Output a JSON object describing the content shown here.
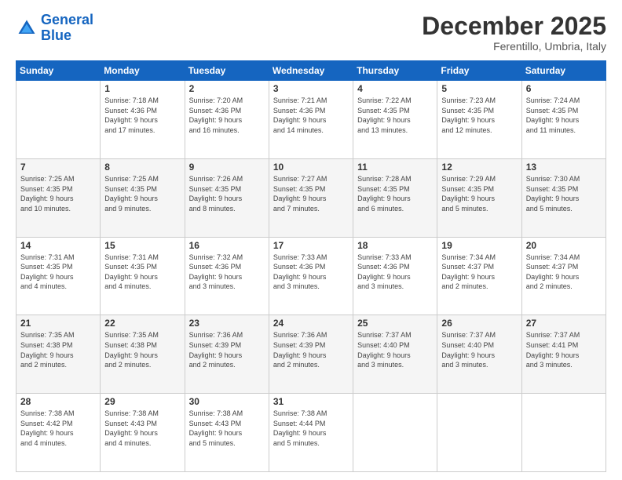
{
  "logo": {
    "line1": "General",
    "line2": "Blue"
  },
  "title": "December 2025",
  "subtitle": "Ferentillo, Umbria, Italy",
  "days_header": [
    "Sunday",
    "Monday",
    "Tuesday",
    "Wednesday",
    "Thursday",
    "Friday",
    "Saturday"
  ],
  "weeks": [
    [
      {
        "num": "",
        "info": ""
      },
      {
        "num": "1",
        "info": "Sunrise: 7:18 AM\nSunset: 4:36 PM\nDaylight: 9 hours\nand 17 minutes."
      },
      {
        "num": "2",
        "info": "Sunrise: 7:20 AM\nSunset: 4:36 PM\nDaylight: 9 hours\nand 16 minutes."
      },
      {
        "num": "3",
        "info": "Sunrise: 7:21 AM\nSunset: 4:36 PM\nDaylight: 9 hours\nand 14 minutes."
      },
      {
        "num": "4",
        "info": "Sunrise: 7:22 AM\nSunset: 4:35 PM\nDaylight: 9 hours\nand 13 minutes."
      },
      {
        "num": "5",
        "info": "Sunrise: 7:23 AM\nSunset: 4:35 PM\nDaylight: 9 hours\nand 12 minutes."
      },
      {
        "num": "6",
        "info": "Sunrise: 7:24 AM\nSunset: 4:35 PM\nDaylight: 9 hours\nand 11 minutes."
      }
    ],
    [
      {
        "num": "7",
        "info": "Sunrise: 7:25 AM\nSunset: 4:35 PM\nDaylight: 9 hours\nand 10 minutes."
      },
      {
        "num": "8",
        "info": "Sunrise: 7:25 AM\nSunset: 4:35 PM\nDaylight: 9 hours\nand 9 minutes."
      },
      {
        "num": "9",
        "info": "Sunrise: 7:26 AM\nSunset: 4:35 PM\nDaylight: 9 hours\nand 8 minutes."
      },
      {
        "num": "10",
        "info": "Sunrise: 7:27 AM\nSunset: 4:35 PM\nDaylight: 9 hours\nand 7 minutes."
      },
      {
        "num": "11",
        "info": "Sunrise: 7:28 AM\nSunset: 4:35 PM\nDaylight: 9 hours\nand 6 minutes."
      },
      {
        "num": "12",
        "info": "Sunrise: 7:29 AM\nSunset: 4:35 PM\nDaylight: 9 hours\nand 5 minutes."
      },
      {
        "num": "13",
        "info": "Sunrise: 7:30 AM\nSunset: 4:35 PM\nDaylight: 9 hours\nand 5 minutes."
      }
    ],
    [
      {
        "num": "14",
        "info": "Sunrise: 7:31 AM\nSunset: 4:35 PM\nDaylight: 9 hours\nand 4 minutes."
      },
      {
        "num": "15",
        "info": "Sunrise: 7:31 AM\nSunset: 4:35 PM\nDaylight: 9 hours\nand 4 minutes."
      },
      {
        "num": "16",
        "info": "Sunrise: 7:32 AM\nSunset: 4:36 PM\nDaylight: 9 hours\nand 3 minutes."
      },
      {
        "num": "17",
        "info": "Sunrise: 7:33 AM\nSunset: 4:36 PM\nDaylight: 9 hours\nand 3 minutes."
      },
      {
        "num": "18",
        "info": "Sunrise: 7:33 AM\nSunset: 4:36 PM\nDaylight: 9 hours\nand 3 minutes."
      },
      {
        "num": "19",
        "info": "Sunrise: 7:34 AM\nSunset: 4:37 PM\nDaylight: 9 hours\nand 2 minutes."
      },
      {
        "num": "20",
        "info": "Sunrise: 7:34 AM\nSunset: 4:37 PM\nDaylight: 9 hours\nand 2 minutes."
      }
    ],
    [
      {
        "num": "21",
        "info": "Sunrise: 7:35 AM\nSunset: 4:38 PM\nDaylight: 9 hours\nand 2 minutes."
      },
      {
        "num": "22",
        "info": "Sunrise: 7:35 AM\nSunset: 4:38 PM\nDaylight: 9 hours\nand 2 minutes."
      },
      {
        "num": "23",
        "info": "Sunrise: 7:36 AM\nSunset: 4:39 PM\nDaylight: 9 hours\nand 2 minutes."
      },
      {
        "num": "24",
        "info": "Sunrise: 7:36 AM\nSunset: 4:39 PM\nDaylight: 9 hours\nand 2 minutes."
      },
      {
        "num": "25",
        "info": "Sunrise: 7:37 AM\nSunset: 4:40 PM\nDaylight: 9 hours\nand 3 minutes."
      },
      {
        "num": "26",
        "info": "Sunrise: 7:37 AM\nSunset: 4:40 PM\nDaylight: 9 hours\nand 3 minutes."
      },
      {
        "num": "27",
        "info": "Sunrise: 7:37 AM\nSunset: 4:41 PM\nDaylight: 9 hours\nand 3 minutes."
      }
    ],
    [
      {
        "num": "28",
        "info": "Sunrise: 7:38 AM\nSunset: 4:42 PM\nDaylight: 9 hours\nand 4 minutes."
      },
      {
        "num": "29",
        "info": "Sunrise: 7:38 AM\nSunset: 4:43 PM\nDaylight: 9 hours\nand 4 minutes."
      },
      {
        "num": "30",
        "info": "Sunrise: 7:38 AM\nSunset: 4:43 PM\nDaylight: 9 hours\nand 5 minutes."
      },
      {
        "num": "31",
        "info": "Sunrise: 7:38 AM\nSunset: 4:44 PM\nDaylight: 9 hours\nand 5 minutes."
      },
      {
        "num": "",
        "info": ""
      },
      {
        "num": "",
        "info": ""
      },
      {
        "num": "",
        "info": ""
      }
    ]
  ]
}
